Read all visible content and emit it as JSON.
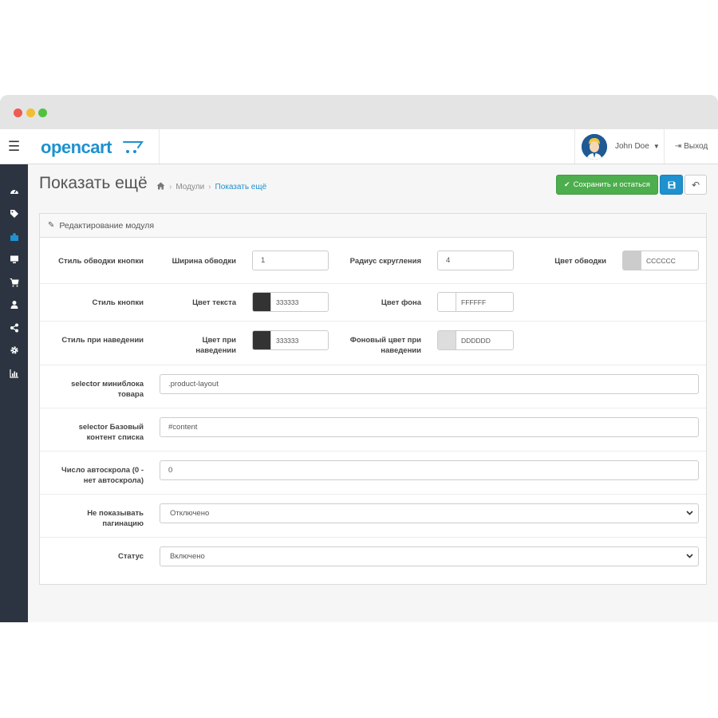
{
  "window": {
    "controls": [
      "close",
      "minimize",
      "maximize"
    ]
  },
  "header": {
    "menu_icon": "hamburger-icon",
    "logo": "opencart",
    "user": {
      "name": "John Doe"
    },
    "logout_label": "Выход"
  },
  "sidebar": {
    "icons": [
      "dashboard-icon",
      "tags-icon",
      "puzzle-icon",
      "desktop-icon",
      "cart-icon",
      "user-icon",
      "share-icon",
      "gear-icon",
      "bar-chart-icon"
    ],
    "active_index": 2
  },
  "page": {
    "title": "Показать ещё",
    "breadcrumb": [
      "Модули",
      "Показать ещё"
    ],
    "buttons": {
      "save_stay": "Сохранить и остаться"
    }
  },
  "panel": {
    "heading": "Редактирование модуля",
    "rows": {
      "button_border": {
        "label": "Стиль обводки кнопки",
        "width_label": "Ширина обводки",
        "width_value": "1",
        "radius_label": "Радиус скругления",
        "radius_value": "4",
        "color_label": "Цвет обводки",
        "color_value": "CCCCCC"
      },
      "button_style": {
        "label": "Стиль кнопки",
        "text_color_label": "Цвет текста",
        "text_color_value": "333333",
        "bg_color_label": "Цвет фона",
        "bg_color_value": "FFFFFF"
      },
      "hover_style": {
        "label": "Стиль при наведении",
        "hover_color_label": "Цвет при наведении",
        "hover_color_value": "333333",
        "hover_bg_label": "Фоновый цвет при наведении",
        "hover_bg_value": "DDDDDD"
      },
      "product_selector": {
        "label": "selector миниблока товара",
        "value": ".product-layout"
      },
      "content_selector": {
        "label": "selector Базовый контент списка",
        "value": "#content"
      },
      "autoscroll": {
        "label": "Число автоскрола (0 - нет автоскрола)",
        "value": "0"
      },
      "hide_pagination": {
        "label": "Не показывать пагинацию",
        "value": "Отключено"
      },
      "status": {
        "label": "Статус",
        "value": "Включено"
      }
    }
  },
  "colors": {
    "primary": "#1e91cf",
    "success": "#4cae4c",
    "sidebar": "#2b3440",
    "swatch_border": "#CCCCCC",
    "swatch_text": "#333333",
    "swatch_bg": "#FFFFFF",
    "swatch_hover": "#333333",
    "swatch_hover_bg": "#DDDDDD"
  }
}
